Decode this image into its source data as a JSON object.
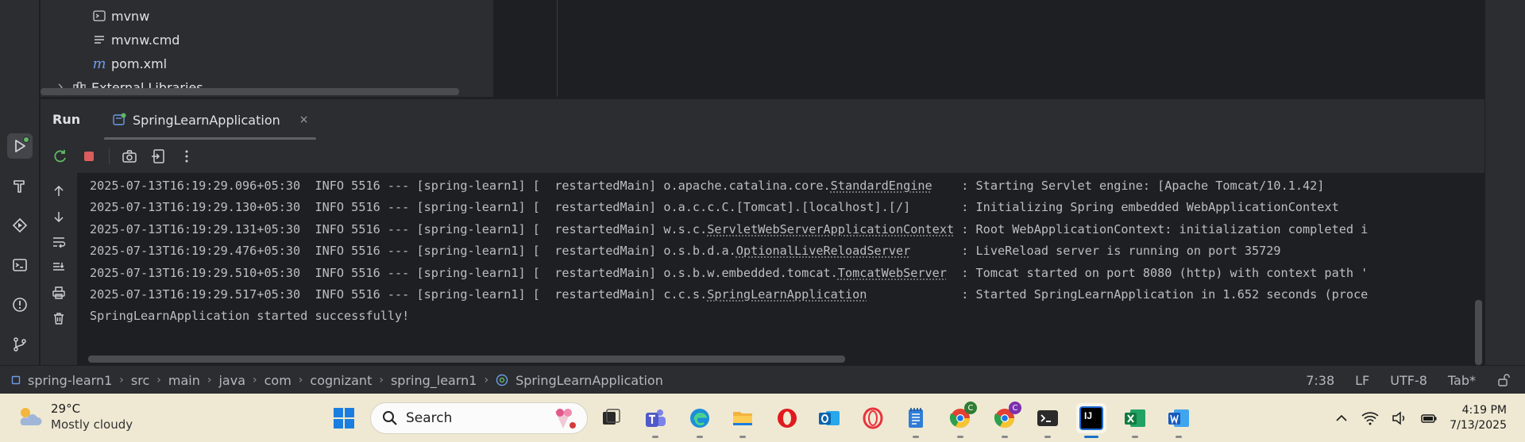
{
  "project_tree": {
    "items": [
      {
        "label": "mvnw",
        "icon": "terminal-script-icon"
      },
      {
        "label": "mvnw.cmd",
        "icon": "text-file-icon"
      },
      {
        "label": "pom.xml",
        "icon": "maven-icon"
      },
      {
        "label": "External Libraries",
        "icon": "library-icon"
      }
    ]
  },
  "run_panel": {
    "title": "Run",
    "tab_label": "SpringLearnApplication",
    "close_glyph": "×"
  },
  "console": {
    "lines": [
      {
        "pre": "2025-07-13T16:19:29.096+05:30  INFO 5516 --- [spring-learn1] [  restartedMain] o.apache.catalina.core.",
        "link": "StandardEngine",
        "post": "    : Starting Servlet engine: [Apache Tomcat/10.1.42]"
      },
      {
        "pre": "2025-07-13T16:19:29.130+05:30  INFO 5516 --- [spring-learn1] [  restartedMain] o.a.c.c.C.[Tomcat].[localhost].[/]       : Initializing Spring embedded WebApplicationContext",
        "link": "",
        "post": ""
      },
      {
        "pre": "2025-07-13T16:19:29.131+05:30  INFO 5516 --- [spring-learn1] [  restartedMain] w.s.c.",
        "link": "ServletWebServerApplicationContext",
        "post": " : Root WebApplicationContext: initialization completed i"
      },
      {
        "pre": "2025-07-13T16:19:29.476+05:30  INFO 5516 --- [spring-learn1] [  restartedMain] o.s.b.d.a.",
        "link": "OptionalLiveReloadServer",
        "post": "       : LiveReload server is running on port 35729"
      },
      {
        "pre": "2025-07-13T16:19:29.510+05:30  INFO 5516 --- [spring-learn1] [  restartedMain] o.s.b.w.embedded.tomcat.",
        "link": "TomcatWebServer",
        "post": "  : Tomcat started on port 8080 (http) with context path '"
      },
      {
        "pre": "2025-07-13T16:19:29.517+05:30  INFO 5516 --- [spring-learn1] [  restartedMain] c.c.s.",
        "link": "SpringLearnApplication",
        "post": "             : Started SpringLearnApplication in 1.652 seconds (proce"
      },
      {
        "pre": "SpringLearnApplication started successfully!",
        "link": "",
        "post": ""
      }
    ]
  },
  "breadcrumbs": [
    "spring-learn1",
    "src",
    "main",
    "java",
    "com",
    "cognizant",
    "spring_learn1",
    "SpringLearnApplication"
  ],
  "status": {
    "position": "7:38",
    "line_separator": "LF",
    "encoding": "UTF-8",
    "indent": "Tab*"
  },
  "taskbar": {
    "weather_temp": "29°C",
    "weather_condition": "Mostly cloudy",
    "search_placeholder": "Search",
    "time": "4:19 PM",
    "date": "7/13/2025",
    "chrome_badge_1": "C",
    "chrome_badge_2": "C",
    "intellij_label": "IJ"
  },
  "colors": {
    "accent_blue": "#3574f0",
    "success_green": "#5fb865",
    "stop_red": "#db5c5c",
    "taskbar_bg": "#efe9d3"
  }
}
